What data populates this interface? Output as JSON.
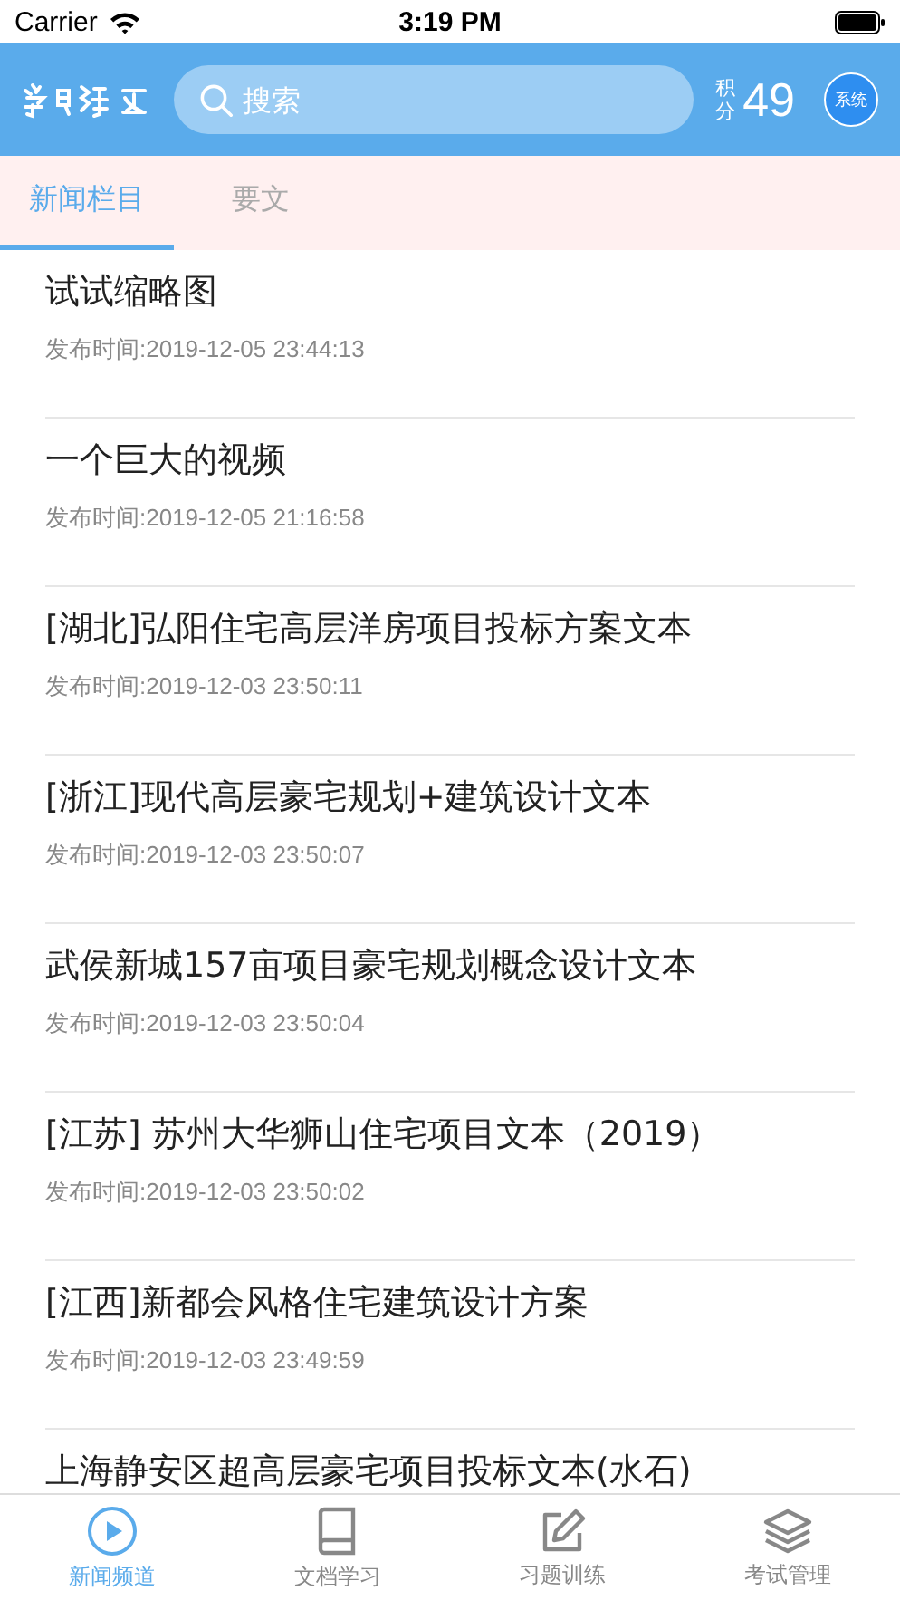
{
  "status_bar": {
    "carrier": "Carrier",
    "time": "3:19 PM"
  },
  "header": {
    "search": {
      "placeholder": "搜索"
    },
    "points_label": "积分",
    "points": "49",
    "system_button": "系统"
  },
  "tabs": [
    {
      "label": "新闻栏目",
      "selected": true
    },
    {
      "label": "要文",
      "selected": false
    }
  ],
  "news": [
    {
      "title": "试试缩略图",
      "date": "发布时间:2019-12-05 23:44:13"
    },
    {
      "title": "一个巨大的视频",
      "date": "发布时间:2019-12-05 21:16:58"
    },
    {
      "title": "[湖北]弘阳住宅高层洋房项目投标方案文本",
      "date": "发布时间:2019-12-03 23:50:11"
    },
    {
      "title": "[浙江]现代高层豪宅规划+建筑设计文本",
      "date": "发布时间:2019-12-03 23:50:07"
    },
    {
      "title": "武侯新城157亩项目豪宅规划概念设计文本",
      "date": "发布时间:2019-12-03 23:50:04"
    },
    {
      "title": "[江苏] 苏州大华狮山住宅项目文本（2019）",
      "date": "发布时间:2019-12-03 23:50:02"
    },
    {
      "title": "[江西]新都会风格住宅建筑设计方案",
      "date": "发布时间:2019-12-03 23:49:59"
    },
    {
      "title": "上海静安区超高层豪宅项目投标文本(水石)"
    }
  ],
  "tab_bar": [
    {
      "kind": "play",
      "label": "新闻频道",
      "selected": true
    },
    {
      "kind": "book",
      "label": "文档学习",
      "selected": false
    },
    {
      "kind": "edit",
      "label": "习题训练",
      "selected": false
    },
    {
      "kind": "layers",
      "label": "考试管理",
      "selected": false
    }
  ]
}
